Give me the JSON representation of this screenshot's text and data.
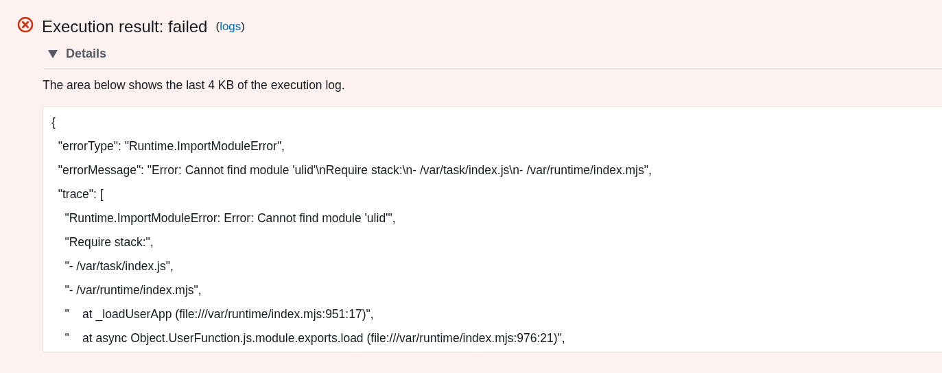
{
  "result": {
    "kind": "error",
    "title": "Execution result: failed",
    "link_open": "(",
    "link": "logs",
    "link_close": ")"
  },
  "details": {
    "label": "Details",
    "expanded": true,
    "description": "The area below shows the last 4 KB of the execution log.",
    "log_lines": [
      "{",
      "  \"errorType\": \"Runtime.ImportModuleError\",",
      "  \"errorMessage\": \"Error: Cannot find module 'ulid'\\nRequire stack:\\n- /var/task/index.js\\n- /var/runtime/index.mjs\",",
      "  \"trace\": [",
      "    \"Runtime.ImportModuleError: Error: Cannot find module 'ulid'\",",
      "    \"Require stack:\",",
      "    \"- /var/task/index.js\",",
      "    \"- /var/runtime/index.mjs\",",
      "    \"    at _loadUserApp (file:///var/runtime/index.mjs:951:17)\",",
      "    \"    at async Object.UserFunction.js.module.exports.load (file:///var/runtime/index.mjs:976:21)\","
    ]
  }
}
